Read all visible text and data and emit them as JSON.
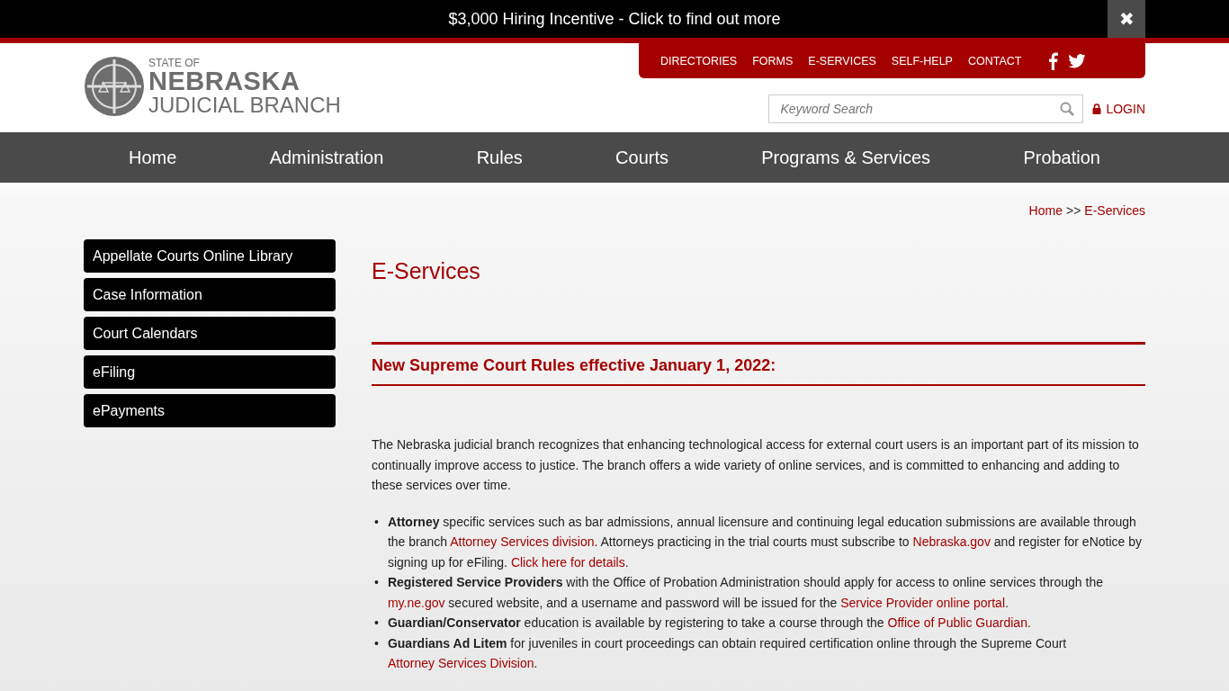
{
  "banner": {
    "text": "$3,000 Hiring Incentive - Click to find out more",
    "close": "✖"
  },
  "logo": {
    "line_1": "STATE OF",
    "line_2": "NEBRASKA",
    "line_3": "JUDICIAL BRANCH"
  },
  "top_nav": [
    "DIRECTORIES",
    "FORMS",
    "E-SERVICES",
    "SELF-HELP",
    "CONTACT"
  ],
  "search": {
    "placeholder": "Keyword Search"
  },
  "login": "LOGIN",
  "main_nav": [
    "Home",
    "Administration",
    "Rules",
    "Courts",
    "Programs & Services",
    "Probation"
  ],
  "breadcrumb": {
    "home": "Home",
    "separator": ">>",
    "current": "E-Services"
  },
  "sidebar": {
    "items": [
      "Appellate Courts Online Library",
      "Case Information",
      "Court Calendars",
      "eFiling",
      "ePayments"
    ]
  },
  "page_title": "E-Services",
  "notice": "New Supreme Court Rules effective January 1, 2022:",
  "intro": "The Nebraska judicial branch recognizes that enhancing technological access for external court users is an important part of its mission to continually improve access to justice.  The branch offers a wide variety of online services, and is committed to enhancing and adding to these services over time.",
  "bullets": [
    {
      "marker": "•",
      "segments": [
        {
          "kind": "bold",
          "text": "Attorney"
        },
        {
          "kind": "plain",
          "text": " specific services such as bar admissions, annual licensure and continuing legal education submissions are available through the branch "
        },
        {
          "kind": "link",
          "text": "Attorney Services division"
        },
        {
          "kind": "plain",
          "text": ". Attorneys practicing in the trial courts must subscribe to "
        },
        {
          "kind": "link",
          "text": "Nebraska.gov"
        },
        {
          "kind": "plain",
          "text": " and register for eNotice by signing up for eFiling. "
        },
        {
          "kind": "link",
          "text": "Click here for details"
        },
        {
          "kind": "plain",
          "text": "."
        }
      ]
    },
    {
      "marker": "•",
      "segments": [
        {
          "kind": "bold",
          "text": "Registered Service Providers"
        },
        {
          "kind": "plain",
          "text": " with the Office of Probation Administration should apply for access to online services through the "
        },
        {
          "kind": "link",
          "text": "my.ne.gov"
        },
        {
          "kind": "plain",
          "text": " secured website, and a username and password will be issued for the "
        },
        {
          "kind": "link",
          "text": "Service Provider online portal"
        },
        {
          "kind": "plain",
          "text": "."
        }
      ]
    },
    {
      "marker": "•",
      "segments": [
        {
          "kind": "bold",
          "text": "Guardian/Conservator"
        },
        {
          "kind": "plain",
          "text": " education is available by registering to take a course through the "
        },
        {
          "kind": "link",
          "text": "Office of Public Guardian"
        },
        {
          "kind": "plain",
          "text": "."
        }
      ]
    },
    {
      "marker": "•",
      "segments": [
        {
          "kind": "bold",
          "text": "Guardians Ad Litem"
        },
        {
          "kind": "plain",
          "text": " for juveniles in court proceedings can obtain required certification online through the Supreme Court "
        },
        {
          "kind": "link",
          "text": "Attorney Services Division"
        },
        {
          "kind": "plain",
          "text": "."
        }
      ]
    }
  ]
}
